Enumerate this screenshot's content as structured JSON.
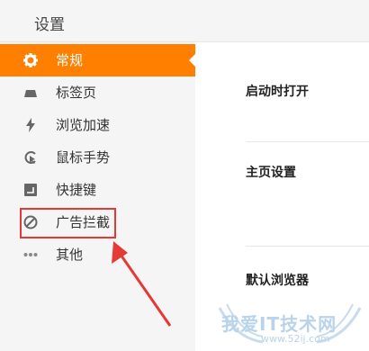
{
  "header": {
    "title": "设置"
  },
  "sidebar": {
    "items": [
      {
        "label": "常规",
        "icon": "gear-icon",
        "active": true
      },
      {
        "label": "标签页",
        "icon": "tab-icon",
        "active": false
      },
      {
        "label": "浏览加速",
        "icon": "lightning-icon",
        "active": false
      },
      {
        "label": "鼠标手势",
        "icon": "mouse-gesture-icon",
        "active": false
      },
      {
        "label": "快捷键",
        "icon": "shortcut-icon",
        "active": false
      },
      {
        "label": "广告拦截",
        "icon": "ad-block-icon",
        "active": false
      },
      {
        "label": "其他",
        "icon": "more-icon",
        "active": false
      }
    ]
  },
  "main": {
    "sections": [
      {
        "label": "启动时打开"
      },
      {
        "label": "主页设置"
      },
      {
        "label": "默认浏览器"
      }
    ]
  },
  "watermark": {
    "text": "我爱IT技术网",
    "url": "www.52ij.com"
  },
  "colors": {
    "accent": "#ff7f00",
    "highlight": "#e53935",
    "icon": "#666666"
  }
}
